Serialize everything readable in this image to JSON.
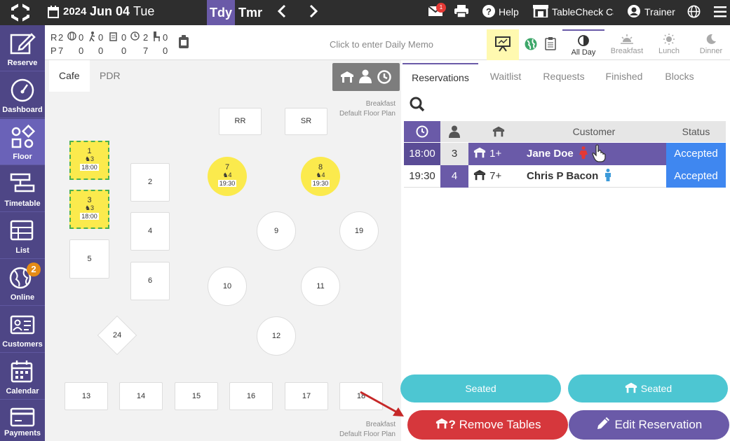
{
  "topbar": {
    "year": "2024",
    "date": "Jun 04",
    "weekday": "Tue",
    "today_label": "Tdy",
    "tomorrow_label": "Tmr",
    "prev_icon": "chevron-left-icon",
    "next_icon": "chevron-right-icon",
    "mail_badge": "1",
    "help_label": "Help",
    "store_label": "TableCheck Ca",
    "user_label": "Trainer"
  },
  "sidebar": {
    "items": [
      {
        "label": "Reserve",
        "icon": "edit-icon"
      },
      {
        "label": "Dashboard",
        "icon": "gauge-icon"
      },
      {
        "label": "Floor",
        "icon": "shapes-icon"
      },
      {
        "label": "Timetable",
        "icon": "timetable-icon"
      },
      {
        "label": "List",
        "icon": "table-icon"
      },
      {
        "label": "Online",
        "icon": "globe-icon",
        "badge": "2"
      },
      {
        "label": "Customers",
        "icon": "id-card-icon"
      },
      {
        "label": "Calendar",
        "icon": "calendar-icon"
      },
      {
        "label": "Payments",
        "icon": "credit-card-icon"
      }
    ]
  },
  "stats": {
    "r_label": "R",
    "r_values": [
      "2",
      "0",
      "0",
      "0",
      "2",
      "0"
    ],
    "p_label": "P",
    "p_values": [
      "7",
      "0",
      "0",
      "0",
      "7",
      "0"
    ],
    "memo_placeholder": "Click to enter Daily Memo"
  },
  "periods": [
    {
      "label": "All Day",
      "active": true
    },
    {
      "label": "Breakfast"
    },
    {
      "label": "Lunch"
    },
    {
      "label": "Dinner"
    }
  ],
  "floor": {
    "tabs": [
      "Cafe",
      "PDR"
    ],
    "plan_period": "Breakfast",
    "plan_name": "Default Floor Plan"
  },
  "tables": {
    "t1": {
      "num": "1",
      "guests": "3",
      "time": "18:00"
    },
    "t3": {
      "num": "3",
      "guests": "3",
      "time": "18:00"
    },
    "t7": {
      "num": "7",
      "guests": "4",
      "time": "19:30"
    },
    "t8": {
      "num": "8",
      "guests": "4",
      "time": "19:30"
    },
    "plain": [
      "RR",
      "SR",
      "2",
      "4",
      "5",
      "6",
      "9",
      "19",
      "10",
      "11",
      "12",
      "24",
      "13",
      "14",
      "15",
      "16",
      "17",
      "18"
    ]
  },
  "rtabs": [
    "Reservations",
    "Waitlist",
    "Requests",
    "Finished",
    "Blocks"
  ],
  "table_head": {
    "customer": "Customer",
    "status": "Status"
  },
  "reservations": [
    {
      "time": "18:00",
      "guests": "3",
      "tables": "1+",
      "customer": "Jane Doe",
      "status": "Accepted"
    },
    {
      "time": "19:30",
      "guests": "4",
      "tables": "7+",
      "customer": "Chris P Bacon",
      "status": "Accepted"
    }
  ],
  "actions": {
    "seated": "Seated",
    "seated_table": "Seated",
    "remove_tables": "Remove Tables",
    "remove_prefix": "?",
    "edit_reservation": "Edit Reservation"
  },
  "colors": {
    "accent": "#6a5aa8",
    "sidebar": "#4e4686",
    "teal": "#4dc6d2",
    "red": "#d6373c",
    "blue": "#3f87f0",
    "yellow": "#fbea4d"
  }
}
